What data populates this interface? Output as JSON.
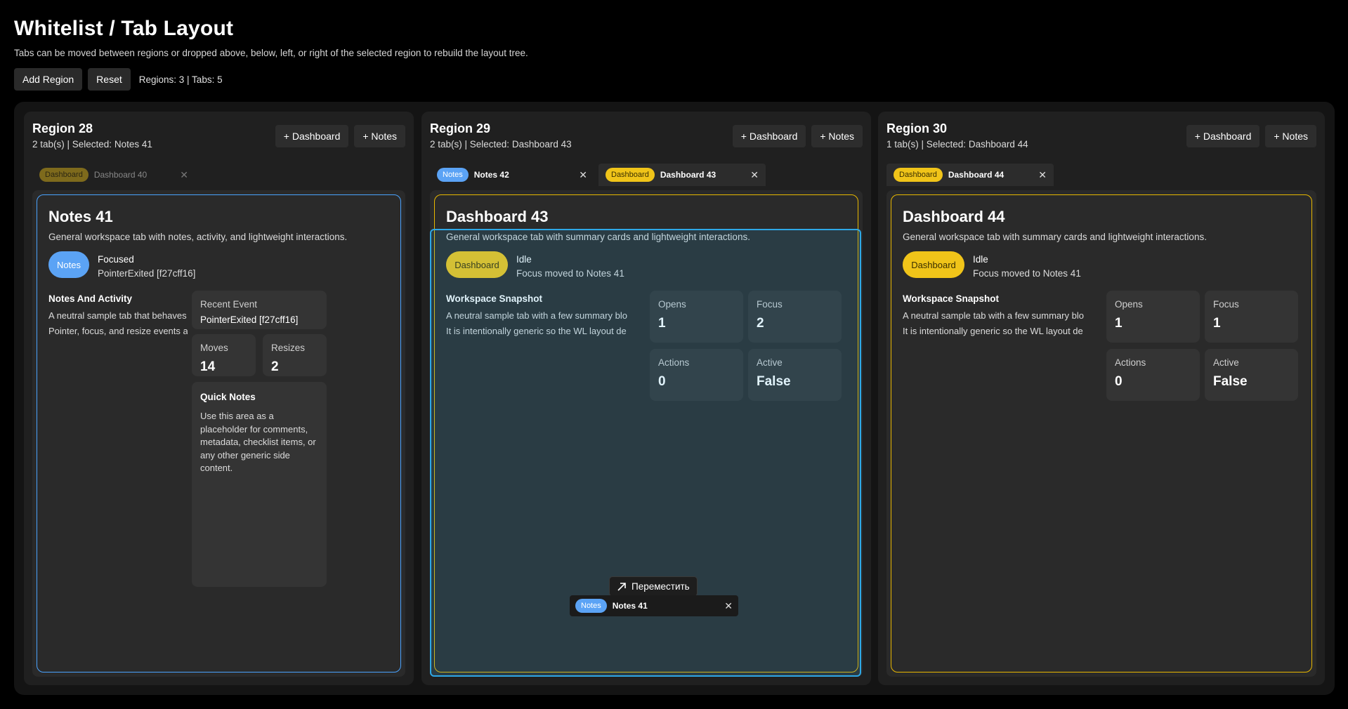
{
  "page": {
    "title": "Whitelist / Tab Layout",
    "subtitle": "Tabs can be moved between regions or dropped above, below, left, or right of the selected region to rebuild the layout tree."
  },
  "toolbar": {
    "add_region_label": "Add Region",
    "reset_label": "Reset",
    "counts": "Regions: 3 | Tabs: 5"
  },
  "colors": {
    "dashboard": "#f0c419",
    "notes": "#5ba3f5",
    "drop_target": "#2ea8e6"
  },
  "regions": [
    {
      "title": "Region 28",
      "info": "2 tab(s) | Selected: Notes 41",
      "add_dashboard": "+ Dashboard",
      "add_notes": "+ Notes",
      "tabs": [
        {
          "kind": "Dashboard",
          "label": "Dashboard 40",
          "close": "✕",
          "dimmed": true
        }
      ],
      "content": {
        "title": "Notes 41",
        "description": "General workspace tab with notes, activity, and lightweight interactions.",
        "badge": "Notes",
        "state": "Focused",
        "event": "PointerExited [f27cff16]",
        "section_title": "Notes And Activity",
        "lines": [
          "A neutral sample tab that behaves like",
          "Pointer, focus, and resize events are sti"
        ],
        "recent_event_label": "Recent Event",
        "recent_event_value": "PointerExited [f27cff16]",
        "moves_label": "Moves",
        "moves_value": "14",
        "resizes_label": "Resizes",
        "resizes_value": "2",
        "quick_title": "Quick Notes",
        "quick_body": "Use this area as a placeholder for comments, metadata, checklist items, or any other generic side content."
      }
    },
    {
      "title": "Region 29",
      "info": "2 tab(s) | Selected: Dashboard 43",
      "add_dashboard": "+ Dashboard",
      "add_notes": "+ Notes",
      "tabs": [
        {
          "kind": "Notes",
          "label": "Notes 42",
          "close": "✕"
        },
        {
          "kind": "Dashboard",
          "label": "Dashboard 43",
          "close": "✕"
        }
      ],
      "content": {
        "title": "Dashboard 43",
        "description": "General workspace tab with summary cards and lightweight interactions.",
        "badge": "Dashboard",
        "state": "Idle",
        "event": "Focus moved to Notes 41",
        "section_title": "Workspace Snapshot",
        "lines": [
          "A neutral sample tab with a few summary blo",
          "It is intentionally generic so the WL layout de"
        ],
        "opens_label": "Opens",
        "opens_value": "1",
        "focus_label": "Focus",
        "focus_value": "2",
        "actions_label": "Actions",
        "actions_value": "0",
        "active_label": "Active",
        "active_value": "False"
      }
    },
    {
      "title": "Region 30",
      "info": "1 tab(s) | Selected: Dashboard 44",
      "add_dashboard": "+ Dashboard",
      "add_notes": "+ Notes",
      "tabs": [
        {
          "kind": "Dashboard",
          "label": "Dashboard 44",
          "close": "✕"
        }
      ],
      "content": {
        "title": "Dashboard 44",
        "description": "General workspace tab with summary cards and lightweight interactions.",
        "badge": "Dashboard",
        "state": "Idle",
        "event": "Focus moved to Notes 41",
        "section_title": "Workspace Snapshot",
        "lines": [
          "A neutral sample tab with a few summary blo",
          "It is intentionally generic so the WL layout de"
        ],
        "opens_label": "Opens",
        "opens_value": "1",
        "focus_label": "Focus",
        "focus_value": "1",
        "actions_label": "Actions",
        "actions_value": "0",
        "active_label": "Active",
        "active_value": "False"
      }
    }
  ],
  "drag": {
    "tooltip": "Переместить",
    "tab_kind": "Notes",
    "tab_label": "Notes 41",
    "close": "✕"
  }
}
